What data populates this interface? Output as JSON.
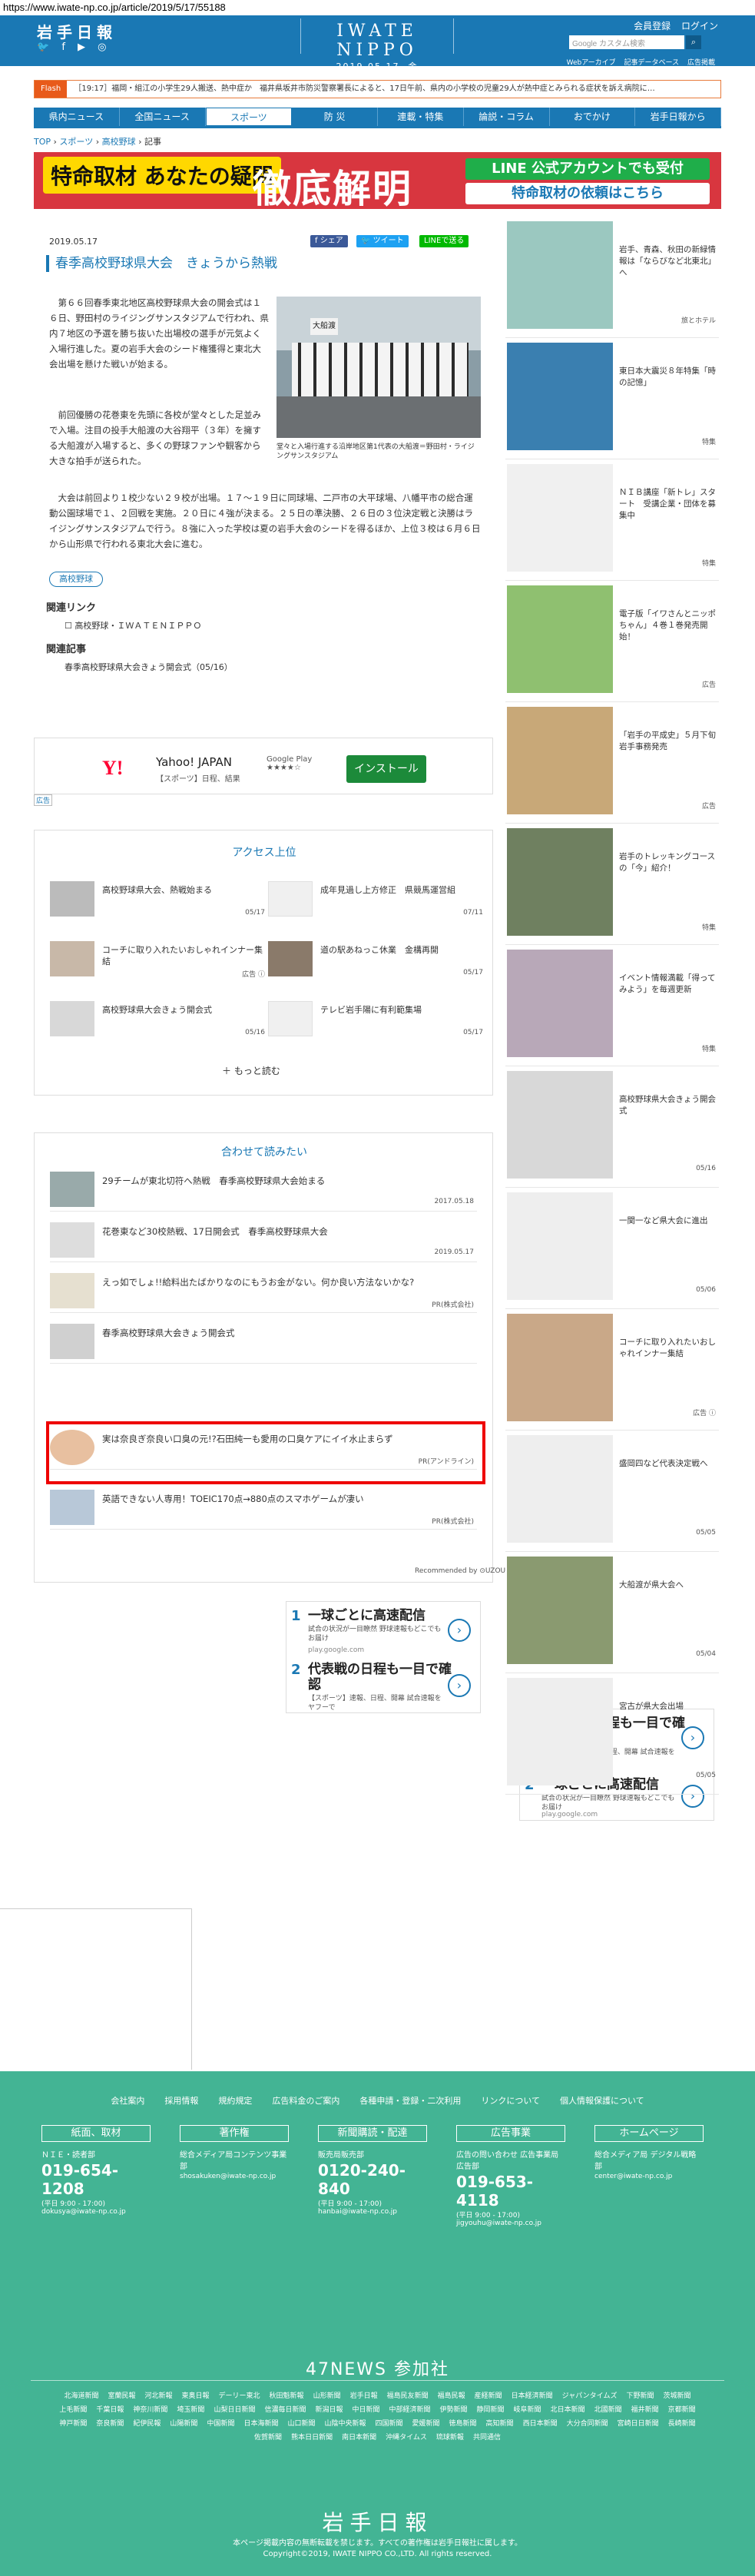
{
  "url": "https://www.iwate-np.co.jp/article/2019/5/17/55188",
  "header": {
    "logo_small": "岩手日報",
    "social_icons": "🐦 f ▶ ◎",
    "masthead": "IWATE NIPPO",
    "masthead_date": "2019.05.17. 金",
    "member_register": "会員登録",
    "login": "ログイン",
    "search_placeholder": "Google カスタム検索",
    "sublinks": [
      "Webアーカイブ",
      "記事データベース",
      "広告掲載"
    ]
  },
  "flash": {
    "label": "Flash",
    "text": "［19:17］福岡・組江の小学生29人搬送、熱中症か　福井県坂井市防災警察署長によると、17日午前、県内の小学校の児童29人が熱中症とみられる症状を訴え病院に…"
  },
  "nav": [
    "県内ニュース",
    "全国ニュース",
    "スポーツ",
    "防 災",
    "連載・特集",
    "論説・コラム",
    "おでかけ",
    "岩手日報から"
  ],
  "breadcrumb": {
    "top": "TOP",
    "sports": "スポーツ",
    "hs": "高校野球",
    "current": "記事"
  },
  "banner": {
    "left": "特命取材 あなたの疑問",
    "mid": "徹底解明",
    "line1": "LINE 公式アカウントでも受付",
    "line2": "特命取材の依頼はこちら"
  },
  "article": {
    "date": "2019.05.17",
    "share_fb": "f シェア",
    "share_tw": "🐦 ツイート",
    "share_line": "LINEで送る",
    "headline": "春季高校野球県大会　きょうから熱戦",
    "photo_sign": "大船渡",
    "caption": "堂々と入場行進する沿岸地区第1代表の大船渡＝野田村・ライジングサンスタジアム",
    "p1": "第６６回春季東北地区高校野球県大会の開会式は１６日、野田村のライジングサンスタジアムで行われ、県内７地区の予選を勝ち抜いた出場校の選手が元気よく入場行進した。夏の岩手大会のシード権獲得と東北大会出場を懸けた戦いが始まる。",
    "p2": "前回優勝の花巻東を先頭に各校が堂々とした足並みで入場。注目の投手大船渡の大谷翔平（３年）を擁する大船渡が入場すると、多くの野球ファンや観客から大きな拍手が送られた。",
    "p3": "大会は前回より１校少ない２９校が出場。１７～１９日に同球場、二戸市の大平球場、八幡平市の総合運動公園球場で１、２回戦を実施。２０日に４強が決まる。２５日の準決勝、２６日の３位決定戦と決勝はライジングサンスタジアムで行う。８強に入った学校は夏の岩手大会のシードを得るほか、上位３校は６月６日から山形県で行われる東北大会に進む。",
    "tag": "高校野球",
    "related_links_title": "関連リンク",
    "related_link": "高校野球・ＩＷＡＴＥＮＩＰＰＯ",
    "related_articles_title": "関連記事",
    "related_article": "春季高校野球県大会きょう開会式（05/16）"
  },
  "yahoo_ad": {
    "brand": "Y!",
    "title": "Yahoo! JAPAN",
    "sub": "【スポーツ】日程、結果",
    "gplay": "Google Play ★★★★☆",
    "install": "インストール",
    "adlabel": "広告"
  },
  "access": {
    "heading": "アクセス上位",
    "items": [
      {
        "title": "高校野球県大会、熱戦始まる",
        "date": "05/17"
      },
      {
        "title": "成年見過し上方修正　県競馬運営組",
        "date": "07/11"
      },
      {
        "title": "コーチに取り入れたいおしゃれインナー集結",
        "date": "広告 ⓘ"
      },
      {
        "title": "道の駅あねっこ休業　金構再開",
        "date": "05/17"
      },
      {
        "title": "高校野球県大会きょう開会式",
        "date": "05/16"
      },
      {
        "title": "テレビ岩手陽に有利範集場",
        "date": "05/17"
      }
    ],
    "more": "＋ もっと読む"
  },
  "related": {
    "heading": "合わせて読みたい",
    "items": [
      {
        "title": "29チームが東北切符へ熱戦　春季高校野球県大会始まる",
        "date": "2017.05.18"
      },
      {
        "title": "花巻東など30校熱戦、17日開会式　春季高校野球県大会",
        "date": "2019.05.17"
      },
      {
        "title": "えっ如でしょ!!給料出たばかりなのにもうお金がない。何か良い方法ないかな?",
        "date": "PR(株式会社)"
      },
      {
        "title": "春季高校野球県大会きょう開会式",
        "date": ""
      },
      {
        "title": "実は奈良ぎ奈良い口臭の元!?石田純一も愛用の口臭ケアにイイ水止まらず",
        "date": "PR(アンドライン)"
      },
      {
        "title": "英語できない人専用！TOEIC170点→880点のスマホゲームが凄い",
        "date": "PR(株式会社)"
      }
    ],
    "recommended": "Recommended by ⊙UZOU"
  },
  "gads_center": [
    {
      "n": "1",
      "title": "一球ごとに高速配信",
      "sub": "試合の状況が一目瞭然 野球速報もどこでもお届け",
      "url": "play.google.com"
    },
    {
      "n": "2",
      "title": "代表戦の日程も一目で確認",
      "sub": "【スポーツ】速報、日程、開幕 試合速報をヤフーで",
      "url": "play.google.com"
    }
  ],
  "gads_side": [
    {
      "n": "1",
      "title": "代表戦の日程も一目で確認",
      "sub": "【スポーツ】速報、日程、開幕 試合速報をヤフーで",
      "url": "play.google.com"
    },
    {
      "n": "2",
      "title": "一球ごとに高速配信",
      "sub": "試合の状況が一目瞭然 野球速報もどこでもお届け",
      "url": "play.google.com"
    }
  ],
  "sidebar": [
    {
      "text": "岩手、青森、秋田の新緑情報は「ならびなど北東北」へ",
      "src": "旅とホテル"
    },
    {
      "text": "東日本大震災８年特集「時の記憶」",
      "src": "特集"
    },
    {
      "text": "ＮＩＢ講座「新トレ」スタート　受講企業・団体を募集中",
      "src": "特集"
    },
    {
      "text": "電子版「イワさんとニッポちゃん」４巻１巻発売開始！",
      "src": "広告"
    },
    {
      "text": "「岩手の平成史」５月下旬岩手事務発売",
      "src": "広告"
    },
    {
      "text": "岩手のトレッキングコースの「今」紹介！",
      "src": "特集"
    },
    {
      "text": "イベント情報満載「得ってみよう」を毎週更新",
      "src": "特集"
    },
    {
      "text": "高校野球県大会きょう開会式",
      "src": "05/16"
    },
    {
      "text": "一関一など県大会に進出",
      "src": "05/06"
    },
    {
      "text": "コーチに取り入れたいおしゃれインナー集結",
      "src": "広告 ⓘ"
    },
    {
      "text": "盛岡四など代表決定戦へ",
      "src": "05/05"
    },
    {
      "text": "大船渡が県大会へ",
      "src": "05/04"
    },
    {
      "text": "宮古が県大会出場",
      "src": "05/05"
    }
  ],
  "footer": {
    "links": [
      "会社案内",
      "採用情報",
      "規約規定",
      "広告料金のご案内",
      "各種申請・登録・二次利用",
      "リンクについて",
      "個人情報保護について"
    ],
    "cols": [
      {
        "head": "紙面、取材",
        "l1": "ＮＩＥ・読者部",
        "tel": "019-654-1208",
        "sm": "(平日 9:00 - 17:00)",
        "mail": "dokusya@iwate-np.co.jp"
      },
      {
        "head": "著作権",
        "l1": "総合メディア局コンテンツ事業部",
        "tel": "",
        "sm": "",
        "mail": "shosakuken@iwate-np.co.jp"
      },
      {
        "head": "新聞購読・配達",
        "l1": "販売局販売部",
        "tel": "0120-240-840",
        "sm": "(平日 9:00 - 17:00)",
        "mail": "hanbai@iwate-np.co.jp"
      },
      {
        "head": "広告事業",
        "l1": "広告の問い合わせ 広告事業局広告部",
        "tel": "019-653-4118",
        "sm": "(平日 9:00 - 17:00)",
        "mail": "jigyouhu@iwate-np.co.jp"
      },
      {
        "head": "ホームページ",
        "l1": "総合メディア局 デジタル戦略部",
        "tel": "",
        "sm": "",
        "mail": "center@iwate-np.co.jp"
      }
    ],
    "news_title": "47NEWS 参加社",
    "members": [
      "北海道新聞",
      "室蘭民報",
      "河北新報",
      "東奥日報",
      "デーリー東北",
      "秋田魁新報",
      "山形新聞",
      "岩手日報",
      "福島民友新聞",
      "福島民報",
      "産経新聞",
      "日本経済新聞",
      "ジャパンタイムズ",
      "下野新聞",
      "茨城新聞",
      "上毛新聞",
      "千葉日報",
      "神奈川新聞",
      "埼玉新聞",
      "山梨日日新聞",
      "信濃毎日新聞",
      "新潟日報",
      "中日新聞",
      "中部経済新聞",
      "伊勢新聞",
      "静岡新聞",
      "岐阜新聞",
      "北日本新聞",
      "北國新聞",
      "福井新聞",
      "京都新聞",
      "神戸新聞",
      "奈良新聞",
      "紀伊民報",
      "山陽新聞",
      "中国新聞",
      "日本海新聞",
      "山口新聞",
      "山陰中央新報",
      "四国新聞",
      "愛媛新聞",
      "徳島新聞",
      "高知新聞",
      "西日本新聞",
      "大分合同新聞",
      "宮崎日日新聞",
      "長崎新聞",
      "佐賀新聞",
      "熊本日日新聞",
      "南日本新聞",
      "沖縄タイムス",
      "琉球新報",
      "共同通信"
    ],
    "logo": "岩手日報",
    "copy1": "本ページ掲載内容の無断転載を禁じます。すべての著作権は岩手日報社に属します。",
    "copy2": "Copyright©2019, IWATE NIPPO CO.,LTD. All rights reserved."
  }
}
